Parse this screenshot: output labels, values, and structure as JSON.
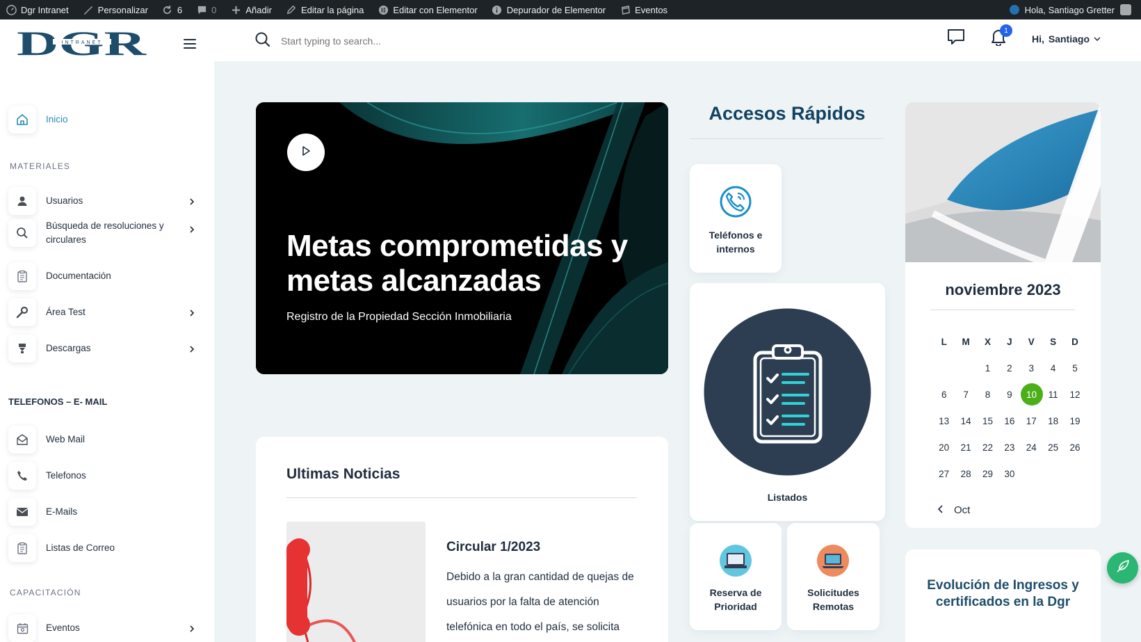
{
  "admin_bar": {
    "site_name": "Dgr Intranet",
    "customize": "Personalizar",
    "updates_count": "6",
    "comments_count": "0",
    "add_new": "Añadir",
    "edit_page": "Editar la página",
    "edit_elementor": "Editar con Elementor",
    "elementor_debugger": "Depurador de Elementor",
    "events": "Eventos",
    "greeting": "Hola, Santiago Gretter"
  },
  "header": {
    "logo_text": "DGR",
    "logo_subtext": "INTRANET",
    "search_placeholder": "Start typing to search...",
    "notifications_count": "1",
    "user_greeting": "Hi,",
    "user_name": "Santiago"
  },
  "sidebar": {
    "home": "Inicio",
    "section_materiales": "MATERIALES",
    "usuarios": "Usuarios",
    "busqueda": "Búsqueda de resoluciones y circulares",
    "documentacion": "Documentación",
    "area_test": "Área Test",
    "descargas": "Descargas",
    "section_telefonos": "TELEFONOS – E- MAIL",
    "web_mail": "Web Mail",
    "telefonos": "Telefonos",
    "emails": "E-Mails",
    "listas_correo": "Listas de Correo",
    "section_capacitacion": "CAPACITACIÓN",
    "eventos": "Eventos"
  },
  "hero": {
    "title": "Metas comprometidas y metas alcanzadas",
    "subtitle": "Registro de la Propiedad Sección Inmobiliaria"
  },
  "news": {
    "heading": "Ultimas Noticias",
    "item_title": "Circular 1/2023",
    "item_excerpt": "Debido a la gran cantidad de quejas de usuarios por la falta de atención telefónica en todo el país, se solicita"
  },
  "quick_access": {
    "title": "Accesos Rápidos",
    "telefonos": "Teléfonos e internos",
    "listados": "Listados",
    "reserva": "Reserva de Prioridad",
    "solicitudes": "Solicitudes Remotas"
  },
  "calendar": {
    "month_title": "noviembre 2023",
    "weekdays": [
      "L",
      "M",
      "X",
      "J",
      "V",
      "S",
      "D"
    ],
    "weeks": [
      [
        "",
        "",
        "1",
        "2",
        "3",
        "4",
        "5"
      ],
      [
        "6",
        "7",
        "8",
        "9",
        "10",
        "11",
        "12"
      ],
      [
        "13",
        "14",
        "15",
        "16",
        "17",
        "18",
        "19"
      ],
      [
        "20",
        "21",
        "22",
        "23",
        "24",
        "25",
        "26"
      ],
      [
        "27",
        "28",
        "29",
        "30",
        "",
        "",
        ""
      ]
    ],
    "today": "10",
    "prev_month": "Oct"
  },
  "widget": {
    "evolution_title": "Evolución de Ingresos y certificados en la Dgr"
  },
  "colors": {
    "accent_green": "#4caf1a",
    "brand_navy": "#1e4d6b",
    "fab_green": "#2bb673"
  }
}
